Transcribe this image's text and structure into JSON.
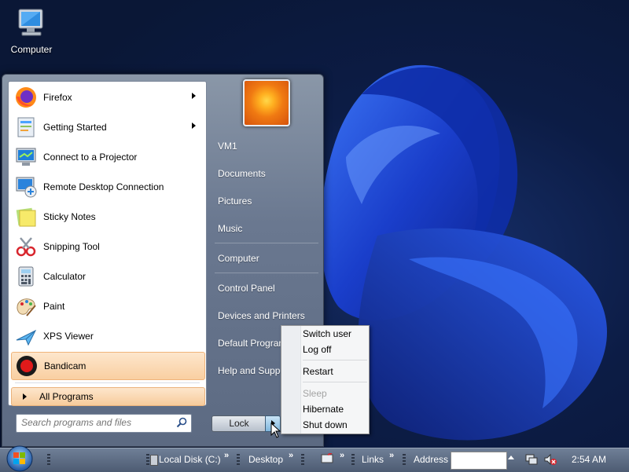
{
  "desktop": {
    "icon_label": "Computer"
  },
  "start_menu": {
    "programs": [
      {
        "label": "Firefox",
        "icon": "firefox-icon",
        "has_arrow": true
      },
      {
        "label": "Getting Started",
        "icon": "getting-started-icon",
        "has_arrow": true
      },
      {
        "label": "Connect to a Projector",
        "icon": "projector-icon",
        "has_arrow": false
      },
      {
        "label": "Remote Desktop Connection",
        "icon": "remote-desktop-icon",
        "has_arrow": false
      },
      {
        "label": "Sticky Notes",
        "icon": "sticky-notes-icon",
        "has_arrow": false
      },
      {
        "label": "Snipping Tool",
        "icon": "snipping-tool-icon",
        "has_arrow": false
      },
      {
        "label": "Calculator",
        "icon": "calculator-icon",
        "has_arrow": false
      },
      {
        "label": "Paint",
        "icon": "paint-icon",
        "has_arrow": false
      },
      {
        "label": "XPS Viewer",
        "icon": "xps-viewer-icon",
        "has_arrow": false
      },
      {
        "label": "Bandicam",
        "icon": "bandicam-icon",
        "has_arrow": false,
        "highlighted": true
      }
    ],
    "all_programs": "All Programs",
    "search_placeholder": "Search programs and files",
    "places": [
      "VM1",
      "Documents",
      "Pictures",
      "Music",
      "Computer",
      "Control Panel",
      "Devices and Printers",
      "Default Programs",
      "Help and Support"
    ],
    "lock_label": "Lock"
  },
  "power_menu": {
    "items": [
      {
        "label": "Switch user",
        "disabled": false
      },
      {
        "label": "Log off",
        "disabled": false
      },
      {
        "label": "Restart",
        "disabled": false
      },
      {
        "label": "Sleep",
        "disabled": true
      },
      {
        "label": "Hibernate",
        "disabled": false
      },
      {
        "label": "Shut down",
        "disabled": false
      }
    ]
  },
  "taskbar": {
    "toolbar_local_disk": "Local Disk (C:)",
    "toolbar_desktop": "Desktop",
    "toolbar_links": "Links",
    "address_label": "Address",
    "address_value": "",
    "clock": "2:54 AM"
  },
  "colors": {
    "highlight": "#f9cfa1",
    "taskbar": "#5b6a82",
    "wallpaper_accent": "#1a4fd8"
  }
}
